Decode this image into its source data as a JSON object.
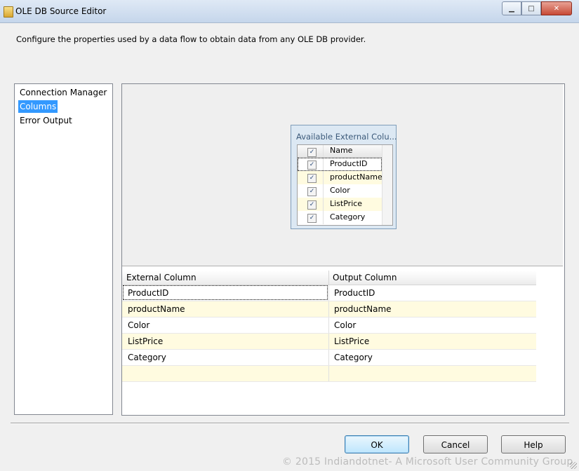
{
  "window": {
    "title": "OLE DB Source Editor",
    "buttons": {
      "minimize": "▁",
      "maximize": "□",
      "close": "✕"
    }
  },
  "description": "Configure the properties used by a data flow to obtain data from any OLE DB provider.",
  "nav": {
    "items": [
      {
        "label": "Connection Manager",
        "selected": false
      },
      {
        "label": "Columns",
        "selected": true
      },
      {
        "label": "Error Output",
        "selected": false
      }
    ]
  },
  "available_columns": {
    "title": "Available External Colu...",
    "header": "Name",
    "check_glyph": "✓",
    "rows": [
      {
        "name": "ProductID",
        "checked": true
      },
      {
        "name": "productName",
        "checked": true
      },
      {
        "name": "Color",
        "checked": true
      },
      {
        "name": "ListPrice",
        "checked": true
      },
      {
        "name": "Category",
        "checked": true
      }
    ]
  },
  "grid": {
    "headers": {
      "external": "External Column",
      "output": "Output Column"
    },
    "rows": [
      {
        "external": "ProductID",
        "output": "ProductID"
      },
      {
        "external": "productName",
        "output": "productName"
      },
      {
        "external": "Color",
        "output": "Color"
      },
      {
        "external": "ListPrice",
        "output": "ListPrice"
      },
      {
        "external": "Category",
        "output": "Category"
      },
      {
        "external": "",
        "output": ""
      }
    ]
  },
  "buttons": {
    "ok": "OK",
    "cancel": "Cancel",
    "help": "Help"
  },
  "watermark": "© 2015 Indiandotnet- A Microsoft User Community Group",
  "colors": {
    "selection": "#3399ff",
    "alt_row": "#fffbe0",
    "column_box": "#dce8f3"
  }
}
